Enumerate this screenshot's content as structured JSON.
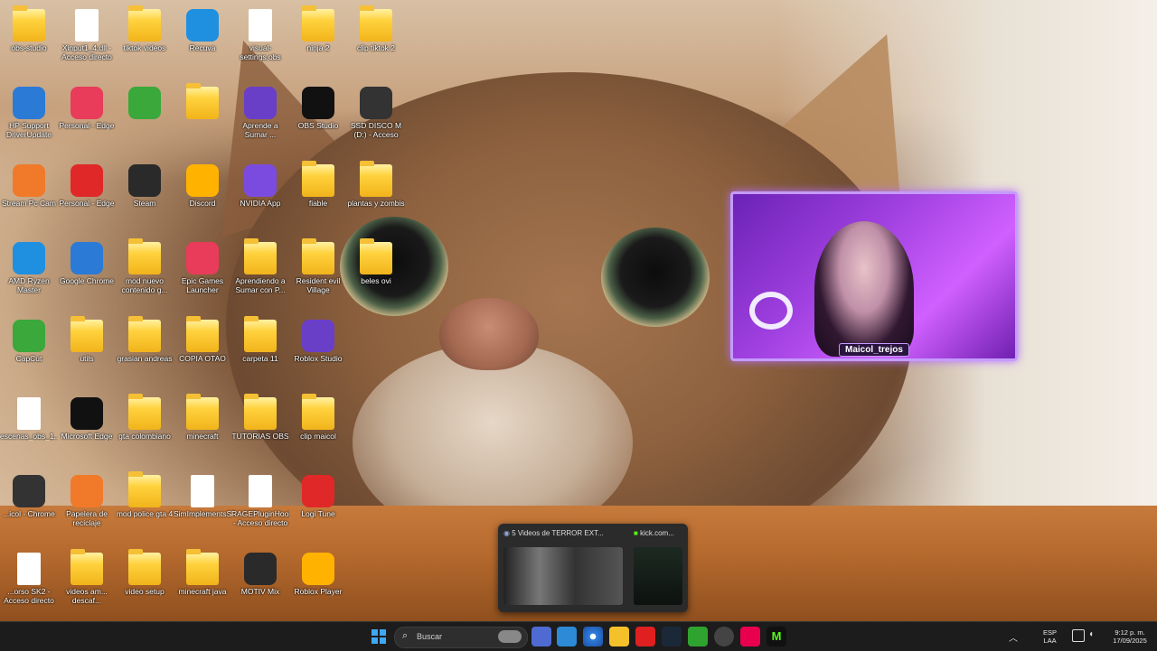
{
  "desktop": {
    "icons": [
      {
        "label": "obs-studio",
        "type": "folder"
      },
      {
        "label": "Xinput1_4.dll - Acceso directo",
        "type": "file"
      },
      {
        "label": "tiktok videos",
        "type": "folder"
      },
      {
        "label": "Recuva",
        "type": "app"
      },
      {
        "label": "visual-settings.obs",
        "type": "file"
      },
      {
        "label": "ninja 2",
        "type": "folder"
      },
      {
        "label": "clip tiktok 2",
        "type": "folder"
      },
      {
        "label": "HP Support DriverUpdate",
        "type": "app"
      },
      {
        "label": "Personal - Edge",
        "type": "app"
      },
      {
        "label": "",
        "type": "app"
      },
      {
        "label": "",
        "type": "folder"
      },
      {
        "label": "Aprende a Sumar ...",
        "type": "app"
      },
      {
        "label": "OBS Studio",
        "type": "app"
      },
      {
        "label": "SSD DISCO M (D:) - Acceso directo",
        "type": "app"
      },
      {
        "label": "Stream Pc Cam",
        "type": "app"
      },
      {
        "label": "Personal - Edge",
        "type": "app"
      },
      {
        "label": "Steam",
        "type": "app"
      },
      {
        "label": "Discord",
        "type": "app"
      },
      {
        "label": "NVIDIA App",
        "type": "app"
      },
      {
        "label": "fiable",
        "type": "folder"
      },
      {
        "label": "plantas y zombis",
        "type": "folder"
      },
      {
        "label": "AMD Ryzen Master",
        "type": "app"
      },
      {
        "label": "Google Chrome",
        "type": "app"
      },
      {
        "label": "mod nuevo contenido g...",
        "type": "folder"
      },
      {
        "label": "Epic Games Launcher",
        "type": "app"
      },
      {
        "label": "Aprendiendo a Sumar con P...",
        "type": "folder"
      },
      {
        "label": "Resident evil Village",
        "type": "folder"
      },
      {
        "label": "beles ovi",
        "type": "folder"
      },
      {
        "label": "CapCut",
        "type": "app"
      },
      {
        "label": "utils",
        "type": "folder"
      },
      {
        "label": "grasian andreas",
        "type": "folder"
      },
      {
        "label": "COPIA OTAO",
        "type": "folder"
      },
      {
        "label": "carpeta 11",
        "type": "folder"
      },
      {
        "label": "Roblox Studio",
        "type": "app"
      },
      {
        "label": "escenas_obs_1...",
        "type": "file"
      },
      {
        "label": "Microsoft Edge",
        "type": "app"
      },
      {
        "label": "gta colombiano",
        "type": "folder"
      },
      {
        "label": "minecraft",
        "type": "folder"
      },
      {
        "label": "TUTORIAS OBS",
        "type": "folder"
      },
      {
        "label": "clip maicol",
        "type": "folder"
      },
      {
        "label": "...icol - Chrome",
        "type": "app"
      },
      {
        "label": "Papelera de reciclaje",
        "type": "app"
      },
      {
        "label": "mod police gta 4",
        "type": "folder"
      },
      {
        "label": "SimImplementsSetting",
        "type": "file"
      },
      {
        "label": "RAGEPluginHook - Acceso directo",
        "type": "file"
      },
      {
        "label": "Logi Tune",
        "type": "app"
      },
      {
        "label": "...orso SK2 - Acceso directo",
        "type": "file"
      },
      {
        "label": "videos am... descaf...",
        "type": "folder"
      },
      {
        "label": "video setup",
        "type": "folder"
      },
      {
        "label": "minecraft java",
        "type": "folder"
      },
      {
        "label": "MOTIV Mix",
        "type": "app"
      },
      {
        "label": "Roblox Player",
        "type": "app"
      }
    ]
  },
  "webcam": {
    "name": "Maicol_trejos"
  },
  "preview": {
    "tab1": "5 Videos de TERROR EXT...",
    "tab2": "kick.com..."
  },
  "taskbar": {
    "search_placeholder": "Buscar",
    "lang_top": "ESP",
    "lang_bottom": "LAA",
    "time": "9:12 p. m.",
    "date": "17/09/2025"
  }
}
